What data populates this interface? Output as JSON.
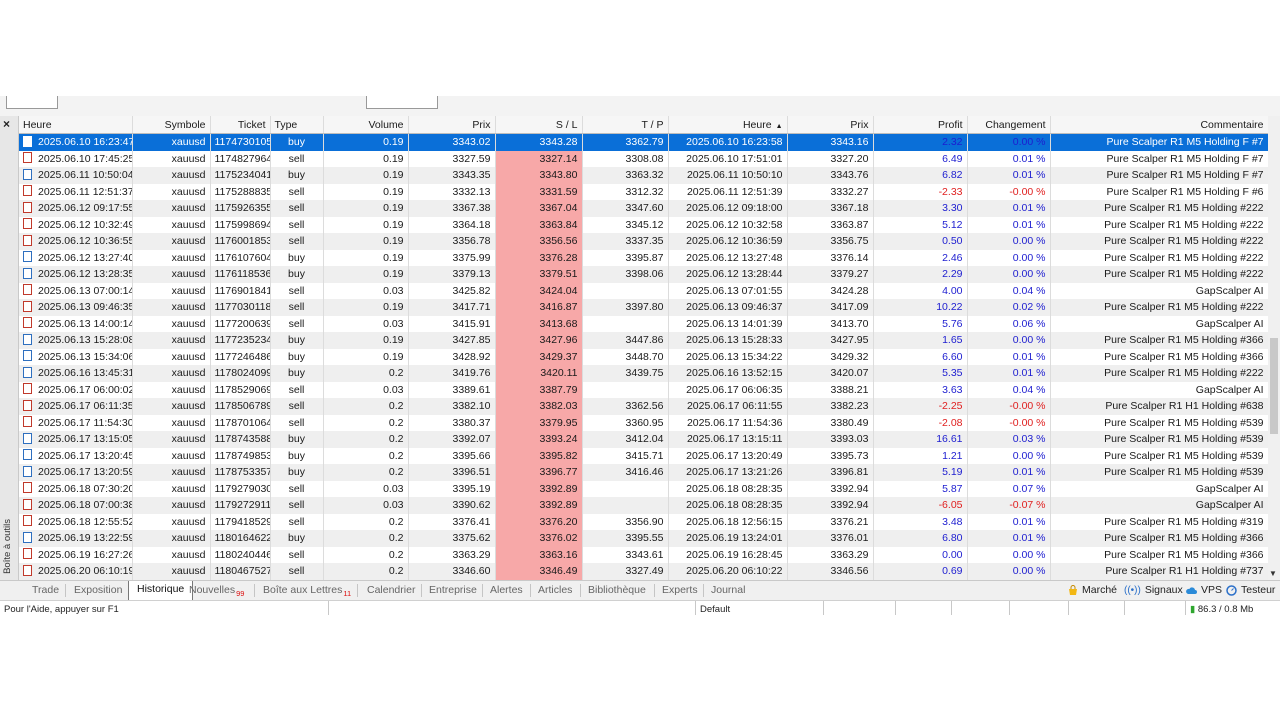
{
  "side_label": "Boîte à outils",
  "headers": {
    "heure": "Heure",
    "symbole": "Symbole",
    "ticket": "Ticket",
    "type": "Type",
    "volume": "Volume",
    "prix": "Prix",
    "sl": "S / L",
    "tp": "T / P",
    "heure2": "Heure",
    "prix2": "Prix",
    "profit": "Profit",
    "changement": "Changement",
    "commentaire": "Commentaire"
  },
  "rows": [
    {
      "open": "2025.06.10 16:23:47",
      "sym": "xauusd",
      "ticket": "1174730105",
      "type": "buy",
      "vol": "0.19",
      "price": "3343.02",
      "sl": "3343.28",
      "tp": "3362.79",
      "close": "2025.06.10 16:23:58",
      "cprice": "3343.16",
      "profit": "2.32",
      "chg": "0.00 %",
      "comment": "Pure Scalper R1 M5 Holding F #7"
    },
    {
      "open": "2025.06.10 17:45:25",
      "sym": "xauusd",
      "ticket": "1174827964",
      "type": "sell",
      "vol": "0.19",
      "price": "3327.59",
      "sl": "3327.14",
      "tp": "3308.08",
      "close": "2025.06.10 17:51:01",
      "cprice": "3327.20",
      "profit": "6.49",
      "chg": "0.01 %",
      "comment": "Pure Scalper R1 M5 Holding F #7"
    },
    {
      "open": "2025.06.11 10:50:04",
      "sym": "xauusd",
      "ticket": "1175234041",
      "type": "buy",
      "vol": "0.19",
      "price": "3343.35",
      "sl": "3343.80",
      "tp": "3363.32",
      "close": "2025.06.11 10:50:10",
      "cprice": "3343.76",
      "profit": "6.82",
      "chg": "0.01 %",
      "comment": "Pure Scalper R1 M5 Holding F #7"
    },
    {
      "open": "2025.06.11 12:51:37",
      "sym": "xauusd",
      "ticket": "1175288835",
      "type": "sell",
      "vol": "0.19",
      "price": "3332.13",
      "sl": "3331.59",
      "tp": "3312.32",
      "close": "2025.06.11 12:51:39",
      "cprice": "3332.27",
      "profit": "-2.33",
      "chg": "-0.00 %",
      "comment": "Pure Scalper R1 M5 Holding F #6"
    },
    {
      "open": "2025.06.12 09:17:55",
      "sym": "xauusd",
      "ticket": "1175926355",
      "type": "sell",
      "vol": "0.19",
      "price": "3367.38",
      "sl": "3367.04",
      "tp": "3347.60",
      "close": "2025.06.12 09:18:00",
      "cprice": "3367.18",
      "profit": "3.30",
      "chg": "0.01 %",
      "comment": "Pure Scalper R1 M5 Holding #222"
    },
    {
      "open": "2025.06.12 10:32:49",
      "sym": "xauusd",
      "ticket": "1175998694",
      "type": "sell",
      "vol": "0.19",
      "price": "3364.18",
      "sl": "3363.84",
      "tp": "3345.12",
      "close": "2025.06.12 10:32:58",
      "cprice": "3363.87",
      "profit": "5.12",
      "chg": "0.01 %",
      "comment": "Pure Scalper R1 M5 Holding #222"
    },
    {
      "open": "2025.06.12 10:36:55",
      "sym": "xauusd",
      "ticket": "1176001853",
      "type": "sell",
      "vol": "0.19",
      "price": "3356.78",
      "sl": "3356.56",
      "tp": "3337.35",
      "close": "2025.06.12 10:36:59",
      "cprice": "3356.75",
      "profit": "0.50",
      "chg": "0.00 %",
      "comment": "Pure Scalper R1 M5 Holding #222"
    },
    {
      "open": "2025.06.12 13:27:40",
      "sym": "xauusd",
      "ticket": "1176107604",
      "type": "buy",
      "vol": "0.19",
      "price": "3375.99",
      "sl": "3376.28",
      "tp": "3395.87",
      "close": "2025.06.12 13:27:48",
      "cprice": "3376.14",
      "profit": "2.46",
      "chg": "0.00 %",
      "comment": "Pure Scalper R1 M5 Holding #222"
    },
    {
      "open": "2025.06.12 13:28:35",
      "sym": "xauusd",
      "ticket": "1176118536",
      "type": "buy",
      "vol": "0.19",
      "price": "3379.13",
      "sl": "3379.51",
      "tp": "3398.06",
      "close": "2025.06.12 13:28:44",
      "cprice": "3379.27",
      "profit": "2.29",
      "chg": "0.00 %",
      "comment": "Pure Scalper R1 M5 Holding #222"
    },
    {
      "open": "2025.06.13 07:00:14",
      "sym": "xauusd",
      "ticket": "1176901841",
      "type": "sell",
      "vol": "0.03",
      "price": "3425.82",
      "sl": "3424.04",
      "tp": "",
      "close": "2025.06.13 07:01:55",
      "cprice": "3424.28",
      "profit": "4.00",
      "chg": "0.04 %",
      "comment": "GapScalper AI"
    },
    {
      "open": "2025.06.13 09:46:35",
      "sym": "xauusd",
      "ticket": "1177030118",
      "type": "sell",
      "vol": "0.19",
      "price": "3417.71",
      "sl": "3416.87",
      "tp": "3397.80",
      "close": "2025.06.13 09:46:37",
      "cprice": "3417.09",
      "profit": "10.22",
      "chg": "0.02 %",
      "comment": "Pure Scalper R1 M5 Holding #222"
    },
    {
      "open": "2025.06.13 14:00:14",
      "sym": "xauusd",
      "ticket": "1177200639",
      "type": "sell",
      "vol": "0.03",
      "price": "3415.91",
      "sl": "3413.68",
      "tp": "",
      "close": "2025.06.13 14:01:39",
      "cprice": "3413.70",
      "profit": "5.76",
      "chg": "0.06 %",
      "comment": "GapScalper AI"
    },
    {
      "open": "2025.06.13 15:28:08",
      "sym": "xauusd",
      "ticket": "1177235234",
      "type": "buy",
      "vol": "0.19",
      "price": "3427.85",
      "sl": "3427.96",
      "tp": "3447.86",
      "close": "2025.06.13 15:28:33",
      "cprice": "3427.95",
      "profit": "1.65",
      "chg": "0.00 %",
      "comment": "Pure Scalper R1 M5 Holding #366"
    },
    {
      "open": "2025.06.13 15:34:06",
      "sym": "xauusd",
      "ticket": "1177246486",
      "type": "buy",
      "vol": "0.19",
      "price": "3428.92",
      "sl": "3429.37",
      "tp": "3448.70",
      "close": "2025.06.13 15:34:22",
      "cprice": "3429.32",
      "profit": "6.60",
      "chg": "0.01 %",
      "comment": "Pure Scalper R1 M5 Holding #366"
    },
    {
      "open": "2025.06.16 13:45:31",
      "sym": "xauusd",
      "ticket": "1178024099",
      "type": "buy",
      "vol": "0.2",
      "price": "3419.76",
      "sl": "3420.11",
      "tp": "3439.75",
      "close": "2025.06.16 13:52:15",
      "cprice": "3420.07",
      "profit": "5.35",
      "chg": "0.01 %",
      "comment": "Pure Scalper R1 M5 Holding #222"
    },
    {
      "open": "2025.06.17 06:00:02",
      "sym": "xauusd",
      "ticket": "1178529069",
      "type": "sell",
      "vol": "0.03",
      "price": "3389.61",
      "sl": "3387.79",
      "tp": "",
      "close": "2025.06.17 06:06:35",
      "cprice": "3388.21",
      "profit": "3.63",
      "chg": "0.04 %",
      "comment": "GapScalper AI"
    },
    {
      "open": "2025.06.17 06:11:35",
      "sym": "xauusd",
      "ticket": "1178506789",
      "type": "sell",
      "vol": "0.2",
      "price": "3382.10",
      "sl": "3382.03",
      "tp": "3362.56",
      "close": "2025.06.17 06:11:55",
      "cprice": "3382.23",
      "profit": "-2.25",
      "chg": "-0.00 %",
      "comment": "Pure Scalper R1 H1 Holding #638"
    },
    {
      "open": "2025.06.17 11:54:30",
      "sym": "xauusd",
      "ticket": "1178701064",
      "type": "sell",
      "vol": "0.2",
      "price": "3380.37",
      "sl": "3379.95",
      "tp": "3360.95",
      "close": "2025.06.17 11:54:36",
      "cprice": "3380.49",
      "profit": "-2.08",
      "chg": "-0.00 %",
      "comment": "Pure Scalper R1 M5 Holding #539"
    },
    {
      "open": "2025.06.17 13:15:05",
      "sym": "xauusd",
      "ticket": "1178743588",
      "type": "buy",
      "vol": "0.2",
      "price": "3392.07",
      "sl": "3393.24",
      "tp": "3412.04",
      "close": "2025.06.17 13:15:11",
      "cprice": "3393.03",
      "profit": "16.61",
      "chg": "0.03 %",
      "comment": "Pure Scalper R1 M5 Holding #539"
    },
    {
      "open": "2025.06.17 13:20:45",
      "sym": "xauusd",
      "ticket": "1178749853",
      "type": "buy",
      "vol": "0.2",
      "price": "3395.66",
      "sl": "3395.82",
      "tp": "3415.71",
      "close": "2025.06.17 13:20:49",
      "cprice": "3395.73",
      "profit": "1.21",
      "chg": "0.00 %",
      "comment": "Pure Scalper R1 M5 Holding #539"
    },
    {
      "open": "2025.06.17 13:20:59",
      "sym": "xauusd",
      "ticket": "1178753357",
      "type": "buy",
      "vol": "0.2",
      "price": "3396.51",
      "sl": "3396.77",
      "tp": "3416.46",
      "close": "2025.06.17 13:21:26",
      "cprice": "3396.81",
      "profit": "5.19",
      "chg": "0.01 %",
      "comment": "Pure Scalper R1 M5 Holding #539"
    },
    {
      "open": "2025.06.18 07:30:20",
      "sym": "xauusd",
      "ticket": "1179279030",
      "type": "sell",
      "vol": "0.03",
      "price": "3395.19",
      "sl": "3392.89",
      "tp": "",
      "close": "2025.06.18 08:28:35",
      "cprice": "3392.94",
      "profit": "5.87",
      "chg": "0.07 %",
      "comment": "GapScalper AI"
    },
    {
      "open": "2025.06.18 07:00:38",
      "sym": "xauusd",
      "ticket": "1179272911",
      "type": "sell",
      "vol": "0.03",
      "price": "3390.62",
      "sl": "3392.89",
      "tp": "",
      "close": "2025.06.18 08:28:35",
      "cprice": "3392.94",
      "profit": "-6.05",
      "chg": "-0.07 %",
      "comment": "GapScalper AI"
    },
    {
      "open": "2025.06.18 12:55:52",
      "sym": "xauusd",
      "ticket": "1179418529",
      "type": "sell",
      "vol": "0.2",
      "price": "3376.41",
      "sl": "3376.20",
      "tp": "3356.90",
      "close": "2025.06.18 12:56:15",
      "cprice": "3376.21",
      "profit": "3.48",
      "chg": "0.01 %",
      "comment": "Pure Scalper R1 M5 Holding #319"
    },
    {
      "open": "2025.06.19 13:22:59",
      "sym": "xauusd",
      "ticket": "1180164622",
      "type": "buy",
      "vol": "0.2",
      "price": "3375.62",
      "sl": "3376.02",
      "tp": "3395.55",
      "close": "2025.06.19 13:24:01",
      "cprice": "3376.01",
      "profit": "6.80",
      "chg": "0.01 %",
      "comment": "Pure Scalper R1 M5 Holding #366"
    },
    {
      "open": "2025.06.19 16:27:26",
      "sym": "xauusd",
      "ticket": "1180240446",
      "type": "sell",
      "vol": "0.2",
      "price": "3363.29",
      "sl": "3363.16",
      "tp": "3343.61",
      "close": "2025.06.19 16:28:45",
      "cprice": "3363.29",
      "profit": "0.00",
      "chg": "0.00 %",
      "comment": "Pure Scalper R1 M5 Holding #366"
    },
    {
      "open": "2025.06.20 06:10:19",
      "sym": "xauusd",
      "ticket": "1180467527",
      "type": "sell",
      "vol": "0.2",
      "price": "3346.60",
      "sl": "3346.49",
      "tp": "3327.49",
      "close": "2025.06.20 06:10:22",
      "cprice": "3346.56",
      "profit": "0.69",
      "chg": "0.00 %",
      "comment": "Pure Scalper R1 H1 Holding #737"
    }
  ],
  "tabs": {
    "trade": "Trade",
    "exposition": "Exposition",
    "historique": "Historique",
    "nouvelles": "Nouvelles",
    "nouvelles_badge": "99",
    "boite": "Boîte aux Lettres",
    "boite_badge": "11",
    "calendrier": "Calendrier",
    "entreprise": "Entreprise",
    "alertes": "Alertes",
    "articles": "Articles",
    "bibliotheque": "Bibliothèque",
    "experts": "Experts",
    "journal": "Journal"
  },
  "right_tools": {
    "marche": "Marché",
    "signaux": "Signaux",
    "vps": "VPS",
    "testeur": "Testeur"
  },
  "status": {
    "help": "Pour l'Aide, appuyer sur F1",
    "profile": "Default",
    "traffic": "86.3 / 0.8 Mb"
  }
}
